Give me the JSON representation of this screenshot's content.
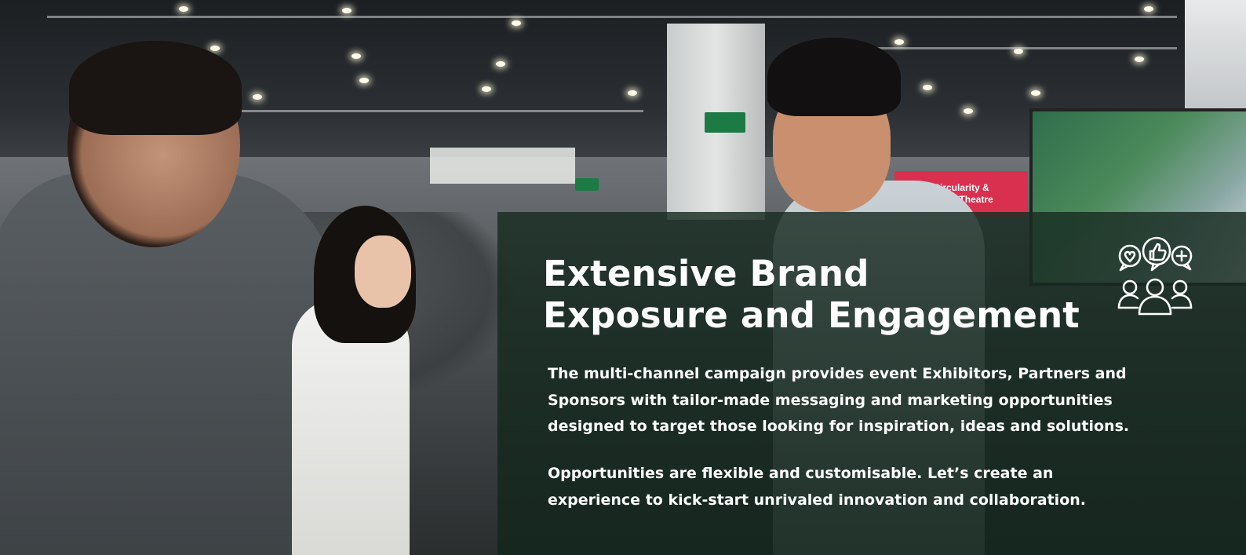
{
  "hero": {
    "title_line1": "Extensive Brand",
    "title_line2": "Exposure and Engagement",
    "paragraph1_line1": "The multi-channel campaign provides event Exhibitors, Partners and",
    "paragraph1_line2": "Sponsors with tailor-made messaging and marketing opportunities",
    "paragraph1_line3": "designed to target those looking for inspiration, ideas and solutions.",
    "paragraph2_line1": "Opportunities are flexible and customisable. Let’s create an",
    "paragraph2_line2": "experience to kick-start unrivaled innovation and collaboration.",
    "icon": "community-engagement-icon",
    "background": "exhibition-hall-photo"
  },
  "scene": {
    "booth_sign_line1": "Circularity &",
    "booth_sign_line2": "Waste Theatre"
  },
  "colors": {
    "overlay": "#182c22",
    "text": "#ffffff",
    "booth_sign": "#d9304f"
  }
}
